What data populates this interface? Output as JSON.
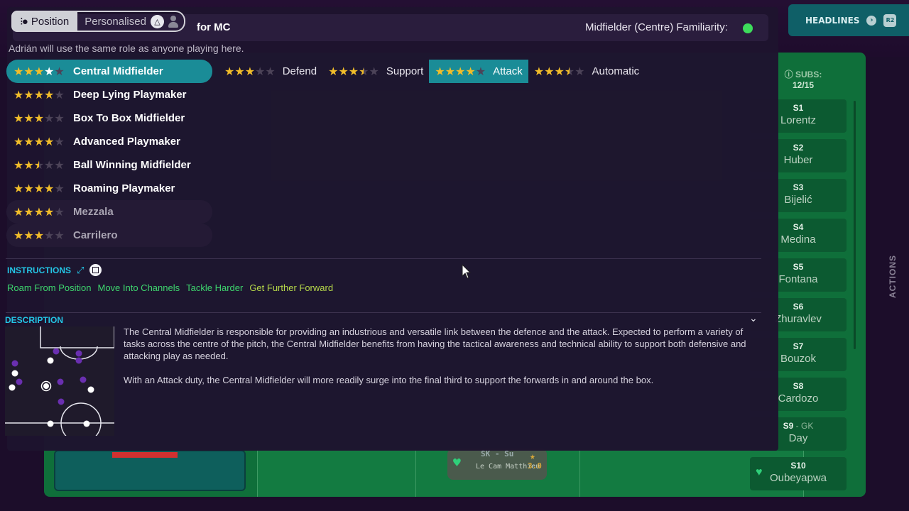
{
  "background": {
    "headlines_label": "HEADLINES",
    "headlines_button": "R2",
    "subs_label": "SUBS:",
    "subs_count": "12/15",
    "actions_label": "ACTIONS",
    "subs": [
      {
        "num": "S1",
        "name": "Lorentz"
      },
      {
        "num": "S2",
        "name": "Huber"
      },
      {
        "num": "S3",
        "name": "Bijelić"
      },
      {
        "num": "S4",
        "name": "Medina"
      },
      {
        "num": "S5",
        "name": "Fontana"
      },
      {
        "num": "S6",
        "name": "Zhuravlev"
      },
      {
        "num": "S7",
        "name": "Bouzok"
      },
      {
        "num": "S8",
        "name": "Cardozo"
      },
      {
        "num": "S9",
        "tag": " - GK",
        "name": "Day"
      },
      {
        "num": "S10",
        "name": "Oubeyapwa"
      }
    ],
    "player_chip": {
      "pos": "SK - Su",
      "name": "Le Cam Matthieu",
      "rating": "3.0"
    }
  },
  "panel": {
    "tabs": {
      "position_label": "Position",
      "personalised_label": "Personalised"
    },
    "for_label": "for MC",
    "familiarity_label": "Midfielder (Centre) Familiarity:",
    "familiarity_color": "#3ddc5b",
    "subtitle": "Adrián will use the same role as anyone playing here.",
    "roles": [
      {
        "name": "Central Midfielder",
        "stars": 3,
        "extra_white": 1,
        "selected": true
      },
      {
        "name": "Deep Lying Playmaker",
        "stars": 4
      },
      {
        "name": "Box To Box Midfielder",
        "stars": 3
      },
      {
        "name": "Advanced Playmaker",
        "stars": 4
      },
      {
        "name": "Ball Winning Midfielder",
        "stars": 2.5
      },
      {
        "name": "Roaming Playmaker",
        "stars": 4
      },
      {
        "name": "Mezzala",
        "stars": 4,
        "dim": true
      },
      {
        "name": "Carrilero",
        "stars": 3,
        "dim": true
      }
    ],
    "duties": [
      {
        "label": "Defend",
        "stars": 3
      },
      {
        "label": "Support",
        "stars": 3.5
      },
      {
        "label": "Attack",
        "stars": 4,
        "active": true
      },
      {
        "label": "Automatic",
        "stars": 3.5
      }
    ],
    "instructions_title": "INSTRUCTIONS",
    "instructions": [
      "Roam From Position",
      "Move Into Channels",
      "Tackle Harder",
      "Get Further Forward"
    ],
    "description_title": "DESCRIPTION",
    "description": [
      "The Central Midfielder is responsible for providing an industrious and versatile link between the defence and the attack. Expected to perform a variety of tasks across the centre of the pitch, the Central Midfielder benefits from having the tactical awareness and technical ability to support both defensive and attacking play as needed.",
      "With an Attack duty, the Central Midfielder will more readily surge into the final third to support the forwards in and around the box."
    ]
  }
}
